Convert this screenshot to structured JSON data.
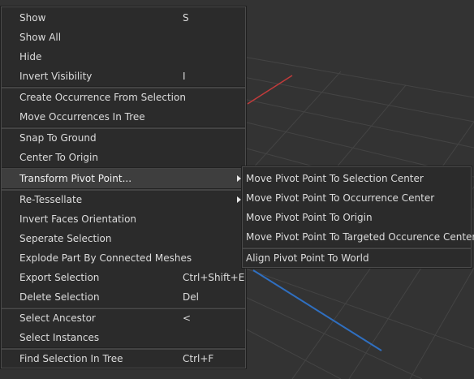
{
  "colors": {
    "background": "#333333",
    "menu_bg": "#2b2b2b",
    "text": "#dcdcdc",
    "grid_line": "#444444",
    "axis_red": "#c23b3b",
    "axis_blue": "#2f6fc0"
  },
  "context_menu": {
    "groups": [
      [
        {
          "label": "Show",
          "shortcut": "S"
        },
        {
          "label": "Show All",
          "shortcut": ""
        },
        {
          "label": "Hide",
          "shortcut": ""
        },
        {
          "label": "Invert Visibility",
          "shortcut": "I"
        }
      ],
      [
        {
          "label": "Create Occurrence From Selection",
          "shortcut": ""
        },
        {
          "label": "Move Occurrences In Tree",
          "shortcut": ""
        }
      ],
      [
        {
          "label": "Snap To Ground",
          "shortcut": ""
        },
        {
          "label": "Center To Origin",
          "shortcut": ""
        }
      ],
      [
        {
          "label": "Transform Pivot Point...",
          "shortcut": "",
          "submenu": true,
          "active": true
        }
      ],
      [
        {
          "label": "Re-Tessellate",
          "shortcut": "",
          "submenu": true
        },
        {
          "label": "Invert Faces Orientation",
          "shortcut": ""
        },
        {
          "label": "Seperate Selection",
          "shortcut": ""
        },
        {
          "label": "Explode Part By Connected Meshes",
          "shortcut": ""
        },
        {
          "label": "Export Selection",
          "shortcut": "Ctrl+Shift+E"
        },
        {
          "label": "Delete Selection",
          "shortcut": "Del"
        }
      ],
      [
        {
          "label": "Select Ancestor",
          "shortcut": "<"
        },
        {
          "label": "Select Instances",
          "shortcut": ""
        }
      ],
      [
        {
          "label": "Find Selection In Tree",
          "shortcut": "Ctrl+F"
        }
      ]
    ]
  },
  "submenu": {
    "groups": [
      [
        {
          "label": "Move Pivot Point To Selection Center"
        },
        {
          "label": "Move Pivot Point To Occurrence Center"
        },
        {
          "label": "Move Pivot Point To Origin"
        },
        {
          "label": "Move Pivot Point To Targeted Occurence Center"
        }
      ],
      [
        {
          "label": "Align Pivot Point To World"
        }
      ]
    ]
  }
}
